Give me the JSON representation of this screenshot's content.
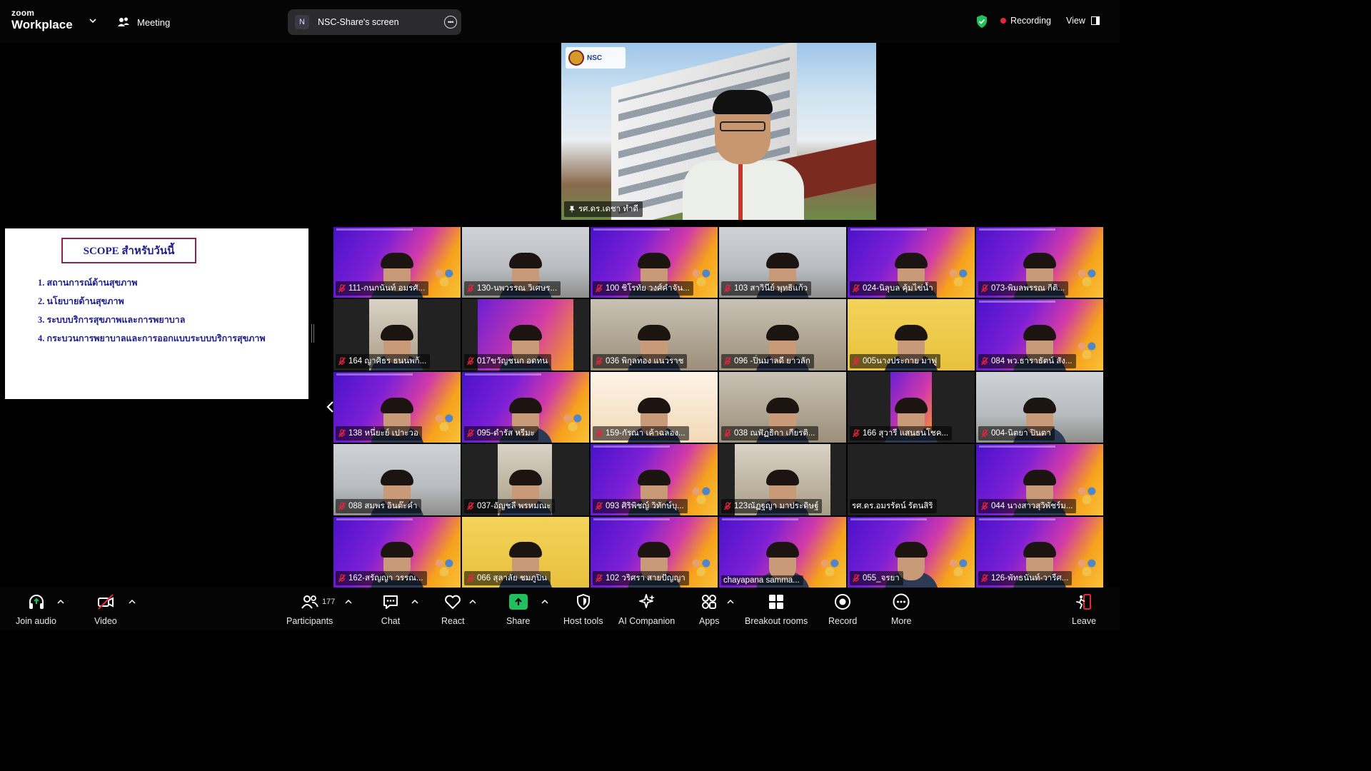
{
  "brand": {
    "top": "zoom",
    "bottom": "Workplace"
  },
  "meeting_label": "Meeting",
  "share": {
    "initial": "N",
    "title": "NSC-Share's screen"
  },
  "recording": "Recording",
  "view": "View",
  "slide": {
    "heading": "SCOPE สำหรับวันนี้",
    "items": [
      "1. สถานการณ์ด้านสุขภาพ",
      "2. นโยบายด้านสุขภาพ",
      "3. ระบบบริการสุขภาพและการพยาบาล",
      "4. กระบวนการพยาบาลและการออกแบบระบบบริการสุขภาพ"
    ]
  },
  "speaker": {
    "name": "รศ.ดร.เดชา ทำดี",
    "logo_text": "NSC"
  },
  "participants": [
    {
      "name": "111-กนกนันท์ อมรศั...",
      "muted": true,
      "bg": "purple"
    },
    {
      "name": "130-นพวรรณ วิเศษร...",
      "muted": true,
      "bg": "room"
    },
    {
      "name": "100 ชิโรทัย วงศ์คำจัน...",
      "muted": true,
      "bg": "purple"
    },
    {
      "name": "103 สาวินีย์ พุทธิแก้ว",
      "muted": true,
      "bg": "room"
    },
    {
      "name": "024-นิลุบล คุ้มไข่น้ำ",
      "muted": true,
      "bg": "purple"
    },
    {
      "name": "073-พิมลพรรณ กิติ...",
      "muted": true,
      "bg": "purple"
    },
    {
      "name": "164 ญาศิธร ธนนพก้...",
      "muted": true,
      "bg": "dark",
      "inset": [
        50,
        118
      ]
    },
    {
      "name": "017ขวัญชนก อดทน",
      "muted": true,
      "bg": "dark",
      "inset": [
        22,
        156
      ],
      "inset_purple": true
    },
    {
      "name": "036 พิกุลทอง แนวราช",
      "muted": true,
      "bg": "office"
    },
    {
      "name": "096 -ปิ่นมาลดี ยาวลัก",
      "muted": true,
      "bg": "office"
    },
    {
      "name": "005นางประกาย มาฟู",
      "muted": true,
      "bg": "yellow"
    },
    {
      "name": "084 พว.ธาราธัตน์ สัง...",
      "muted": true,
      "bg": "purple"
    },
    {
      "name": "138 หนึ่ยะย์ เปาะวอ",
      "muted": true,
      "bg": "purple"
    },
    {
      "name": "095-ดำรัส หรีมะ",
      "muted": true,
      "bg": "purple"
    },
    {
      "name": "159-กัรณา เค้าฉลอง...",
      "muted": true,
      "bg": "cartoon"
    },
    {
      "name": "038 ณฟัฏธิกา เกียรติ...",
      "muted": true,
      "bg": "office"
    },
    {
      "name": "166 สุวารี แสนธนโชค...",
      "muted": true,
      "bg": "dark",
      "inset": [
        60,
        118
      ],
      "inset_purple": true
    },
    {
      "name": "004-นิตยา ปินตา",
      "muted": true,
      "bg": "room"
    },
    {
      "name": "088 สมพร อินต๊ะคำ",
      "muted": true,
      "bg": "room"
    },
    {
      "name": "037-อัญชลี พรหมณะ",
      "muted": true,
      "bg": "dark",
      "inset": [
        50,
        126
      ]
    },
    {
      "name": "093 ศิริพิชญ์ วิทักษ์บุ...",
      "muted": true,
      "bg": "purple"
    },
    {
      "name": "123ณัฏฐญา มาประดิษฐ์",
      "muted": true,
      "bg": "dark",
      "inset": [
        22,
        156
      ]
    },
    {
      "name": "รศ.ดร.อมรรัตน์ รัตนสิริ",
      "muted": false,
      "bg": "dark"
    },
    {
      "name": "044 นางสาวสุวิพัชร์ม...",
      "muted": true,
      "bg": "purple"
    },
    {
      "name": "162-สรัญญา วรรณ...",
      "muted": true,
      "bg": "purple"
    },
    {
      "name": "066 สุลาลัย ชมภูปิน",
      "muted": true,
      "bg": "yellow"
    },
    {
      "name": "102 วริศรา สายปัญญา",
      "muted": true,
      "bg": "purple"
    },
    {
      "name": "chayapana samma...",
      "muted": false,
      "bg": "purple"
    },
    {
      "name": "055_จรยา",
      "muted": true,
      "bg": "purple"
    },
    {
      "name": "126-พัทธนันท์-วารีศ...",
      "muted": true,
      "bg": "purple"
    }
  ],
  "toolbar": {
    "join_audio": "Join audio",
    "video": "Video",
    "participants": "Participants",
    "participants_count": "177",
    "chat": "Chat",
    "react": "React",
    "share": "Share",
    "host_tools": "Host tools",
    "ai_companion": "AI Companion",
    "apps": "Apps",
    "breakout": "Breakout rooms",
    "record": "Record",
    "more": "More",
    "leave": "Leave"
  },
  "colors": {
    "mute": "#e8243c",
    "share_green": "#20c05c",
    "slide_text": "#1f1f8c",
    "slide_border": "#8b2252"
  }
}
